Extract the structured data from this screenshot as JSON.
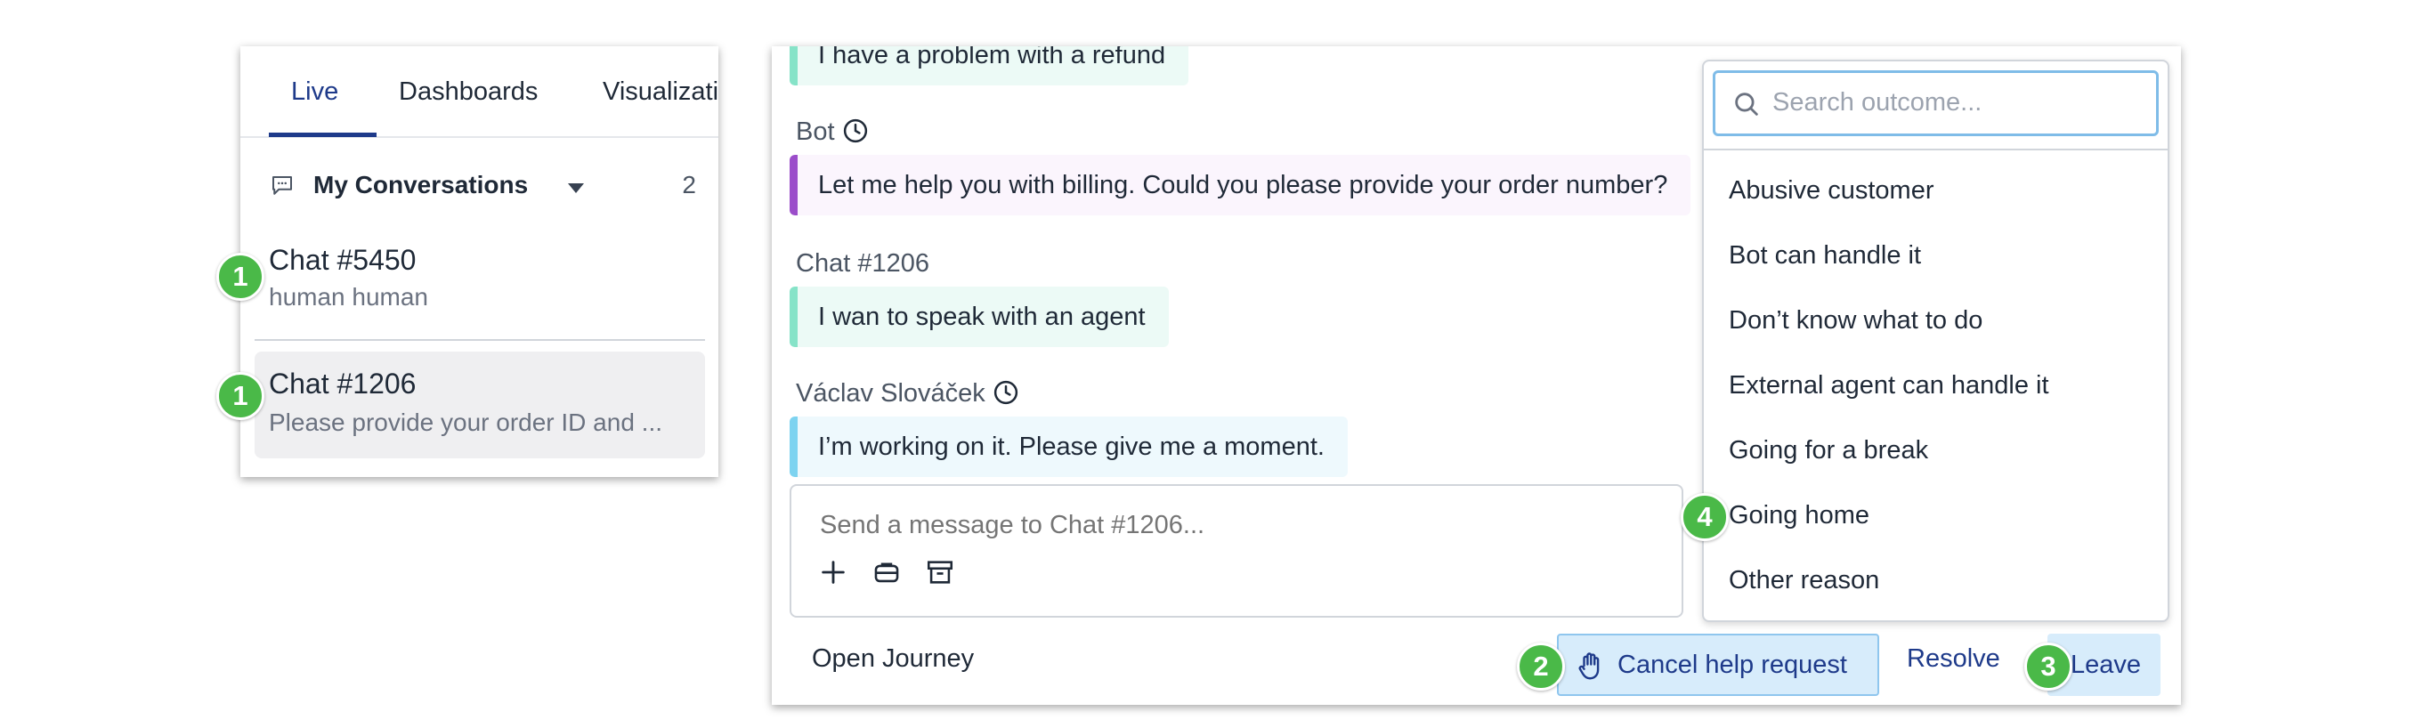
{
  "left_panel": {
    "tabs": [
      {
        "label": "Live",
        "active": true
      },
      {
        "label": "Dashboards",
        "active": false
      },
      {
        "label": "Visualizati",
        "active": false
      }
    ],
    "section": {
      "title": "My Conversations",
      "count": "2",
      "icon": "chat-bubble-icon",
      "caret_icon": "caret-down-icon"
    },
    "chats": [
      {
        "title": "Chat #5450",
        "subtitle": "human human",
        "selected": false
      },
      {
        "title": "Chat #1206",
        "subtitle": "Please provide your order ID and ...",
        "selected": true
      }
    ]
  },
  "conversation": {
    "messages": [
      {
        "sender": "",
        "text": "I have a problem with a refund",
        "kind": "user"
      },
      {
        "sender": "Bot",
        "text": "Let me help you with billing. Could you please provide your order number?",
        "kind": "bot",
        "clock_icon": true
      },
      {
        "sender": "Chat #1206",
        "text": "I wan to speak with an agent",
        "kind": "user"
      },
      {
        "sender": "Václav Slováček",
        "text": "I’m working on it. Please give me a moment.",
        "kind": "agent",
        "clock_icon": true
      }
    ],
    "composer": {
      "placeholder": "Send a message to Chat #1206...",
      "tools": [
        "plus-icon",
        "canned-responses-icon",
        "archive-icon"
      ]
    },
    "footer": {
      "open_journey": "Open Journey",
      "cancel_help": "Cancel help request",
      "resolve": "Resolve",
      "leave": "Leave"
    }
  },
  "outcome_dropdown": {
    "search_placeholder": "Search outcome...",
    "items": [
      "Abusive customer",
      "Bot can handle it",
      "Don’t know what to do",
      "External agent can handle it",
      "Going for a break",
      "Going home",
      "Other reason"
    ]
  },
  "markers": [
    "1",
    "1",
    "2",
    "3",
    "4"
  ],
  "colors": {
    "marker_green": "#4ab948",
    "accent_navy": "#1e3a8a",
    "button_blue": "#d7ecfb",
    "user_bubble": "#ecfaf6",
    "bot_bubble": "#fbf5fd",
    "agent_bubble": "#eef9fd"
  }
}
